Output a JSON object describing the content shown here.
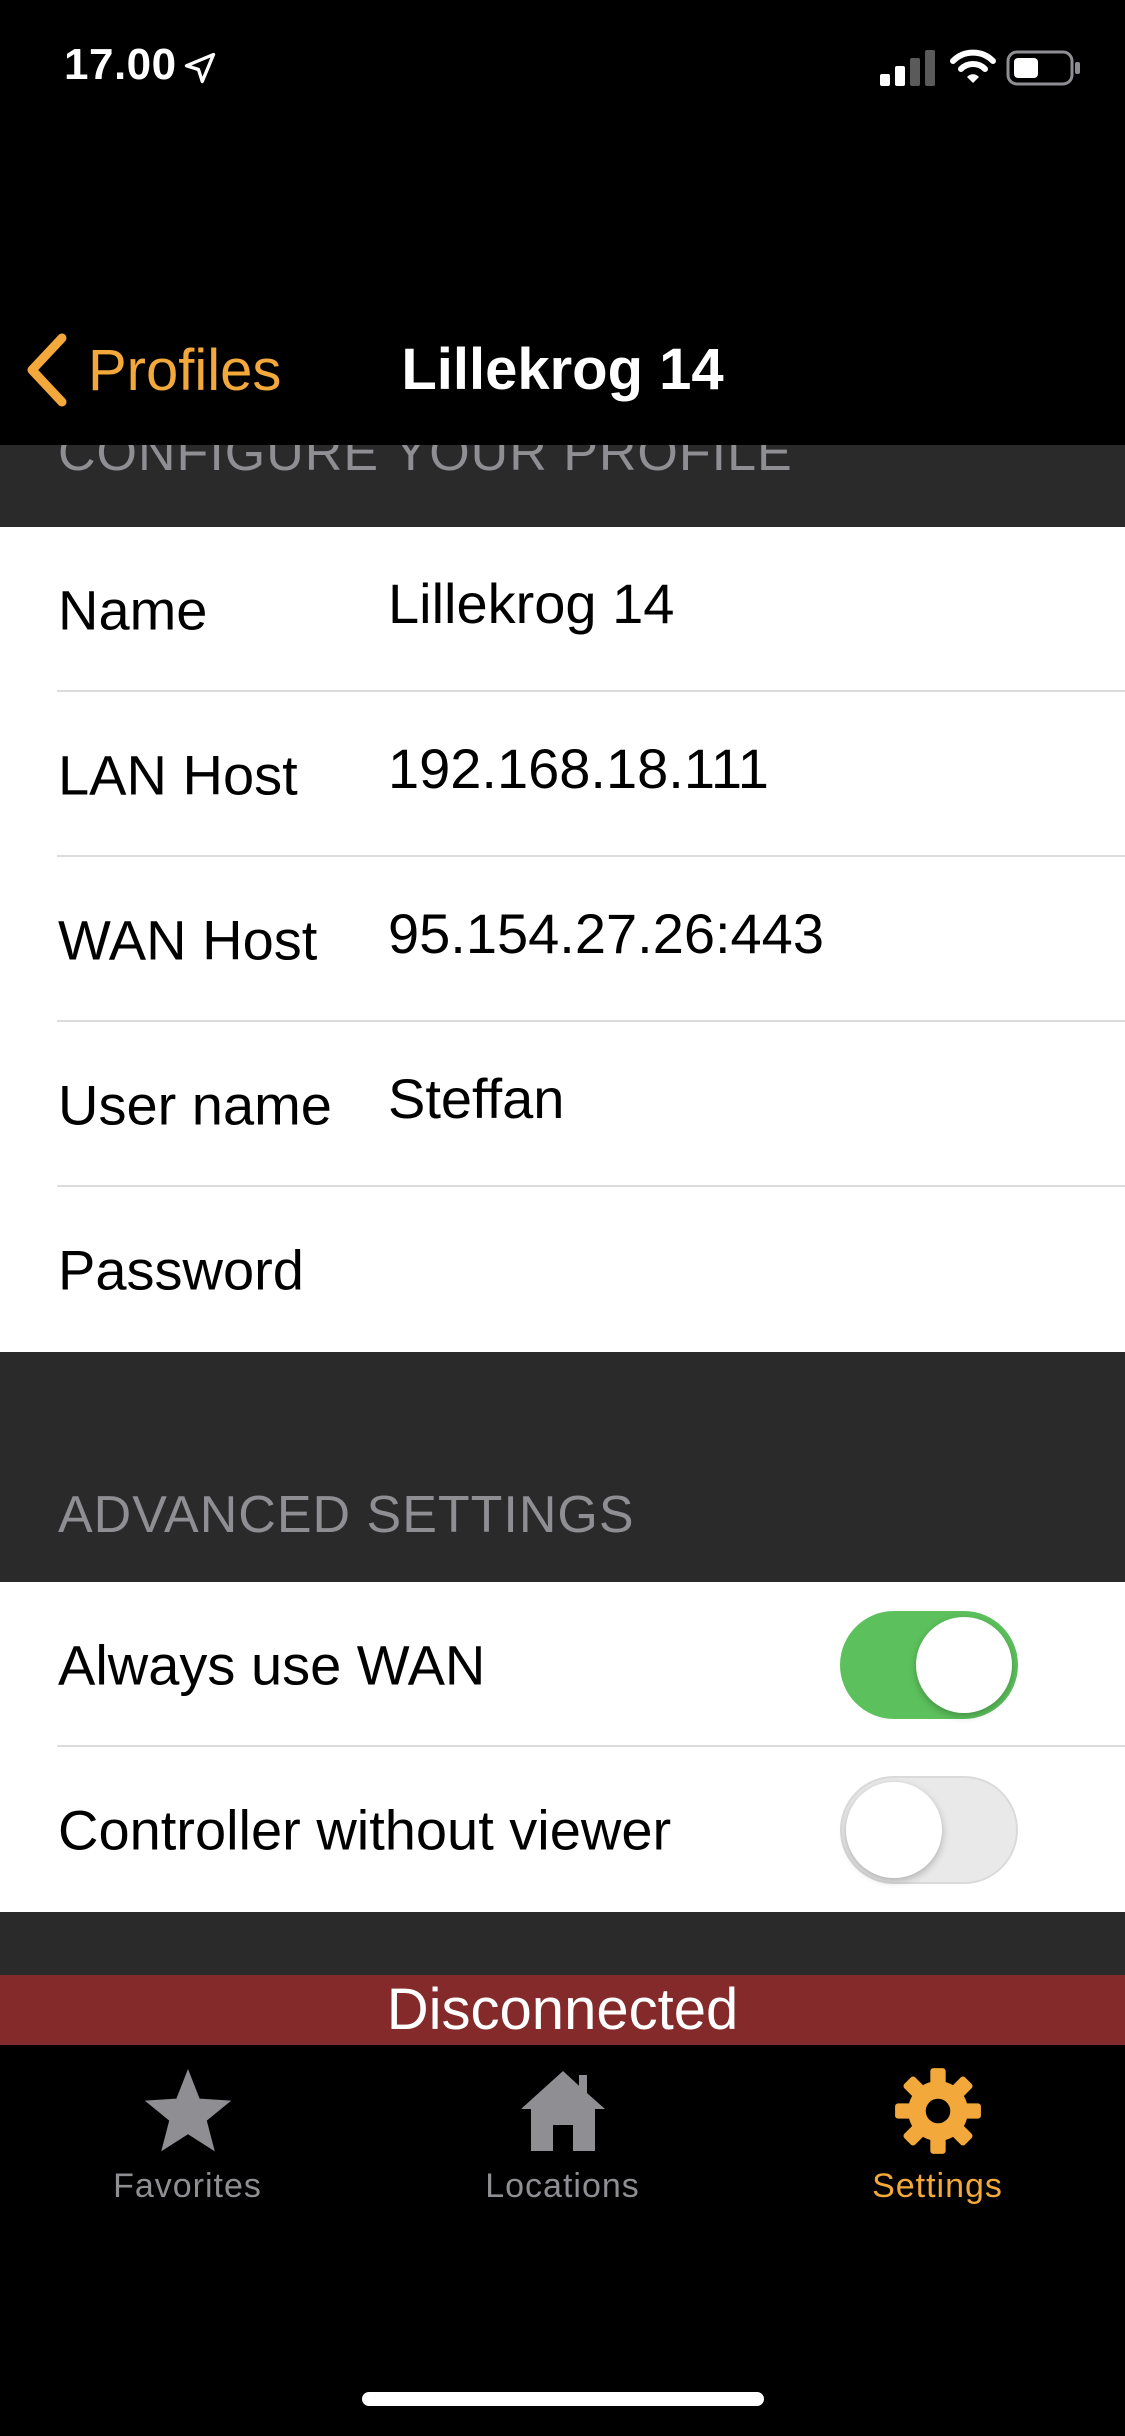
{
  "status_bar": {
    "time": "17.00"
  },
  "nav": {
    "back_label": "Profiles",
    "title": "Lillekrog 14"
  },
  "sections": {
    "configure_header": "CONFIGURE YOUR PROFILE",
    "advanced_header": "ADVANCED SETTINGS"
  },
  "profile": {
    "rows": [
      {
        "label": "Name",
        "value": "Lillekrog 14"
      },
      {
        "label": "LAN Host",
        "value": "192.168.18.111"
      },
      {
        "label": "WAN Host",
        "value": "95.154.27.26:443"
      },
      {
        "label": "User name",
        "value": "Steffan"
      },
      {
        "label": "Password",
        "value": ""
      }
    ]
  },
  "advanced": {
    "rows": [
      {
        "label": "Always use WAN",
        "enabled": true
      },
      {
        "label": "Controller without viewer",
        "enabled": false
      }
    ]
  },
  "banner": {
    "text": "Disconnected"
  },
  "tabs": [
    {
      "label": "Favorites",
      "icon": "star-icon",
      "active": false
    },
    {
      "label": "Locations",
      "icon": "house-icon",
      "active": false
    },
    {
      "label": "Settings",
      "icon": "gear-icon",
      "active": true
    }
  ],
  "colors": {
    "accent": "#F2A83A",
    "toggle_on": "#5cc15c",
    "banner": "#852a2b",
    "section_bg": "#2a2a2b"
  }
}
